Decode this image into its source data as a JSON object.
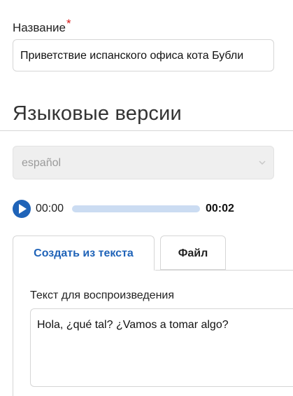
{
  "form": {
    "name_label": "Название",
    "required_mark": "*",
    "name_value": "Приветствие испанского офиса кота Бубли"
  },
  "section": {
    "title": "Языковые версии"
  },
  "language_select": {
    "value": "español",
    "disabled": true
  },
  "audio": {
    "current_time": "00:00",
    "total_time": "00:02",
    "progress": 0
  },
  "tabs": [
    {
      "label": "Создать из текста",
      "active": true
    },
    {
      "label": "Файл",
      "active": false
    }
  ],
  "tts": {
    "label": "Текст для воспроизведения",
    "text": "Hola, ¿qué tal? ¿Vamos a tomar algo?"
  },
  "colors": {
    "accent": "#1f63b8",
    "required": "#d81b1b",
    "progress_track": "#cbdcf2"
  },
  "icons": {
    "play": "play-icon",
    "select": "chevron-down-icon"
  }
}
